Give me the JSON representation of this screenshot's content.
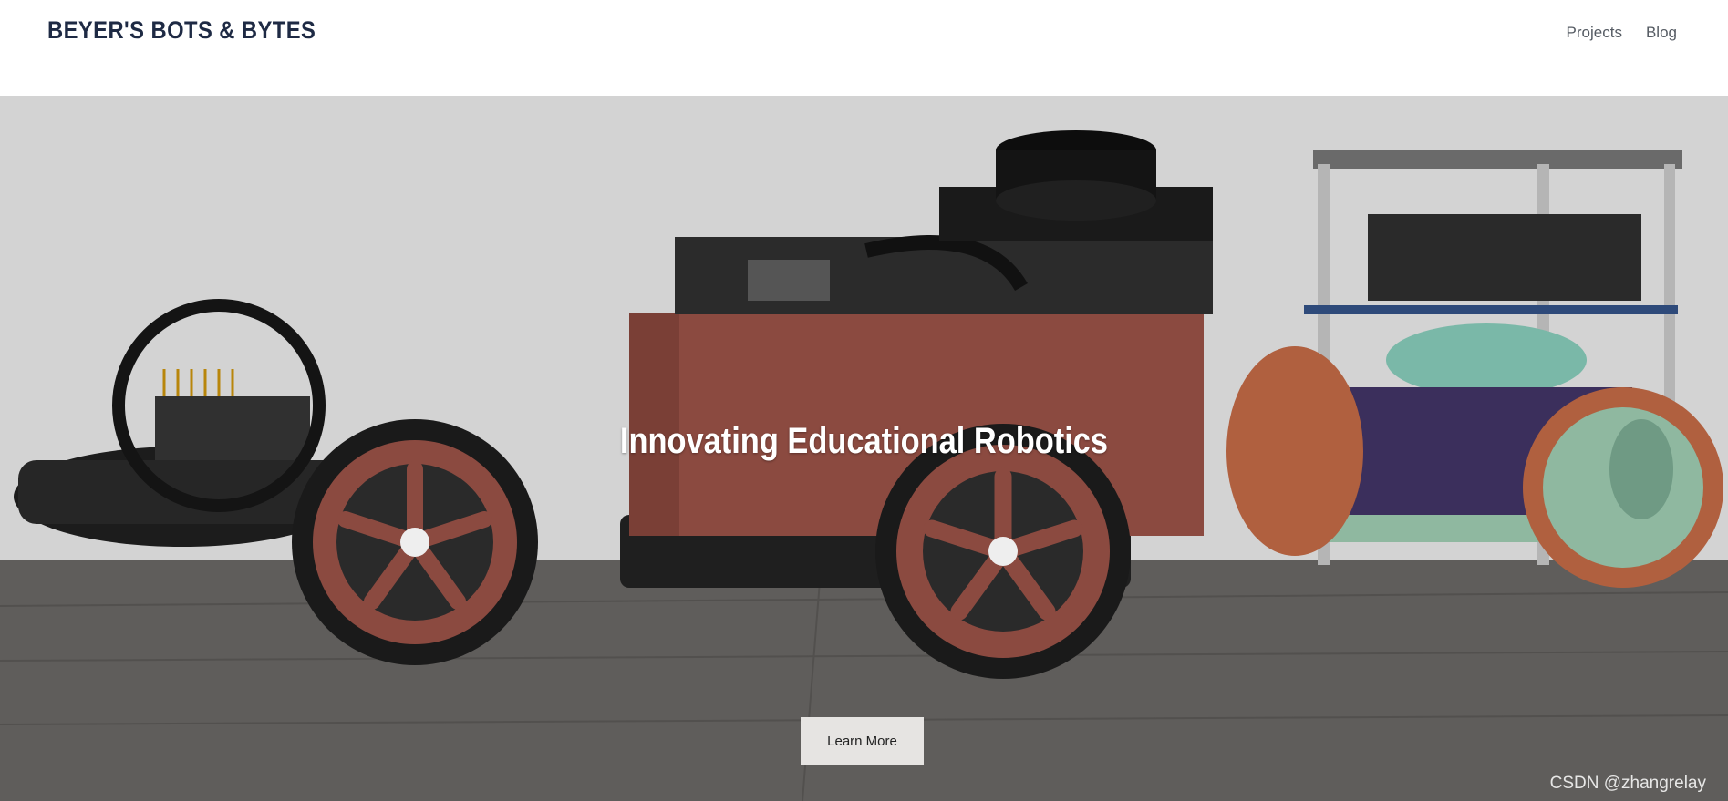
{
  "header": {
    "site_title": "BEYER'S BOTS & BYTES",
    "nav": [
      {
        "label": "Projects"
      },
      {
        "label": "Blog"
      }
    ]
  },
  "hero": {
    "heading": "Innovating Educational Robotics",
    "cta_label": "Learn More",
    "image_description_icon": "robots-photo",
    "colors": {
      "header_title": "#1e2a44",
      "button_bg": "#e6e4e2",
      "robot_red": "#8b4a40",
      "robot_green": "#8fb8a0"
    }
  },
  "watermark": "CSDN @zhangrelay"
}
